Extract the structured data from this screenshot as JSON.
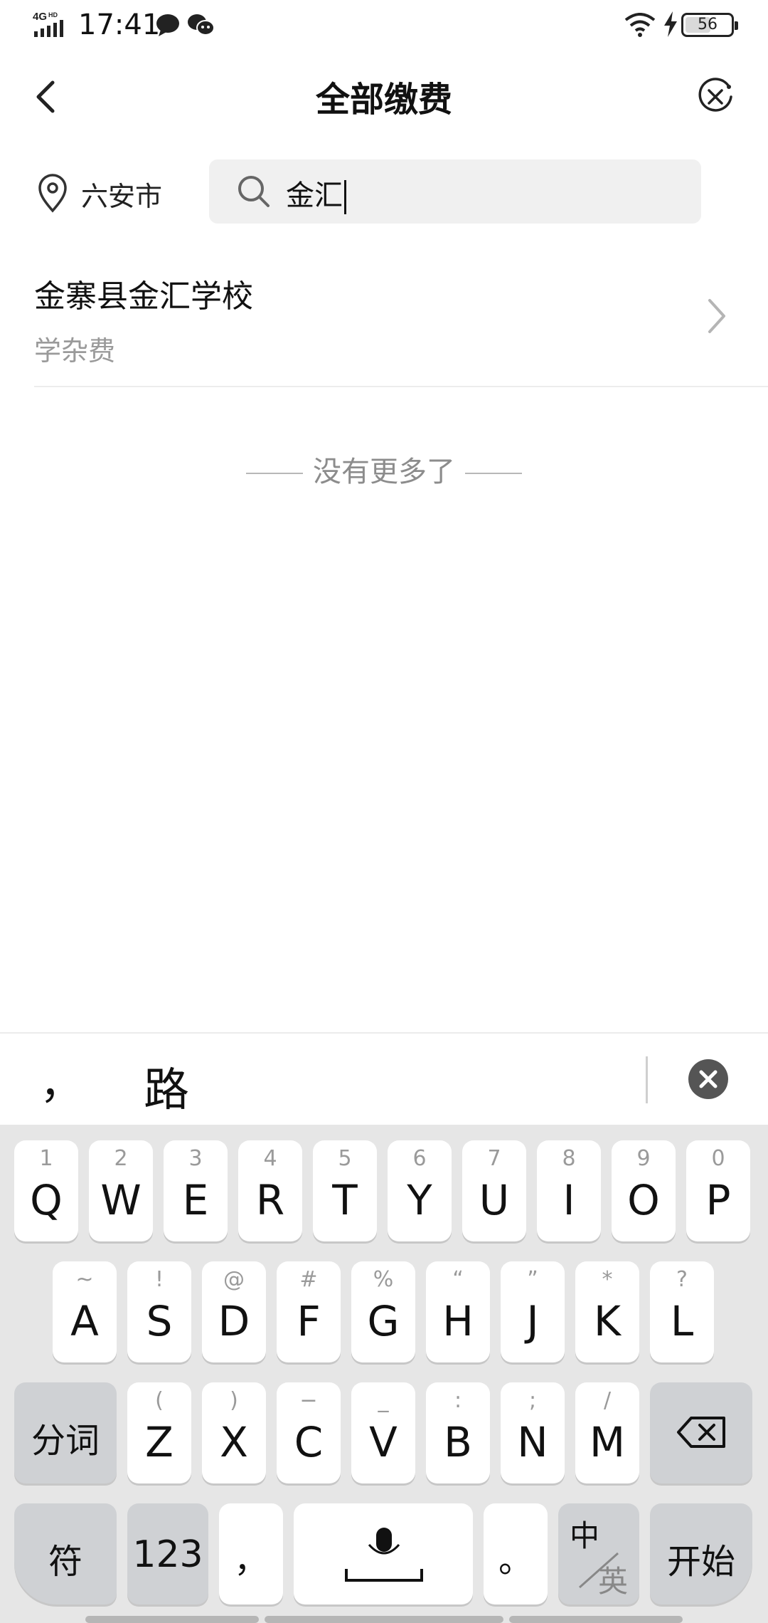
{
  "status_bar": {
    "network": "4GHD",
    "time": "17:41",
    "battery": "56",
    "battery_level": 0.56
  },
  "nav": {
    "title": "全部缴费"
  },
  "search": {
    "city": "六安市",
    "query": "金汇"
  },
  "results": [
    {
      "name": "金寨县金汇学校",
      "subtitle": "学杂费"
    }
  ],
  "end_note": "没有更多了",
  "candidates": {
    "comma": "，",
    "word": "路"
  },
  "keyboard": {
    "row1": [
      {
        "sup": "1",
        "key": "Q"
      },
      {
        "sup": "2",
        "key": "W"
      },
      {
        "sup": "3",
        "key": "E"
      },
      {
        "sup": "4",
        "key": "R"
      },
      {
        "sup": "5",
        "key": "T"
      },
      {
        "sup": "6",
        "key": "Y"
      },
      {
        "sup": "7",
        "key": "U"
      },
      {
        "sup": "8",
        "key": "I"
      },
      {
        "sup": "9",
        "key": "O"
      },
      {
        "sup": "0",
        "key": "P"
      }
    ],
    "row2": [
      {
        "sup": "~",
        "key": "A"
      },
      {
        "sup": "!",
        "key": "S"
      },
      {
        "sup": "@",
        "key": "D"
      },
      {
        "sup": "#",
        "key": "F"
      },
      {
        "sup": "%",
        "key": "G"
      },
      {
        "sup": "“",
        "key": "H"
      },
      {
        "sup": "”",
        "key": "J"
      },
      {
        "sup": "*",
        "key": "K"
      },
      {
        "sup": "?",
        "key": "L"
      }
    ],
    "row3": [
      {
        "sup": "(",
        "key": "Z"
      },
      {
        "sup": ")",
        "key": "X"
      },
      {
        "sup": "−",
        "key": "C"
      },
      {
        "sup": "_",
        "key": "V"
      },
      {
        "sup": ":",
        "key": "B"
      },
      {
        "sup": ";",
        "key": "N"
      },
      {
        "sup": "/",
        "key": "M"
      }
    ],
    "split_word": "分词",
    "symbols": "符",
    "numbers": "123",
    "comma": "，",
    "period": "。",
    "lang_zh": "中",
    "lang_en": "英",
    "go": "开始"
  }
}
